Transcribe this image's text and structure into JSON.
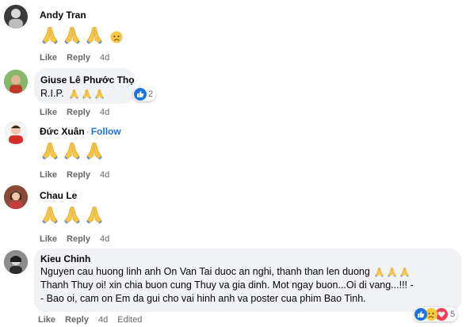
{
  "comments": [
    {
      "author": "Andy Tran",
      "text": "",
      "emoji_count": 3,
      "extra_emoji": "sad-emoji",
      "actions": {
        "like": "Like",
        "reply": "Reply",
        "time": "4d"
      }
    },
    {
      "author": "Giuse Lê Phước Thọ",
      "text": "R.I.P.",
      "emoji_count": 3,
      "reaction_count": "2",
      "actions": {
        "like": "Like",
        "reply": "Reply",
        "time": "4d"
      }
    },
    {
      "author": "Đức Xuân",
      "follow": "Follow",
      "text": "",
      "emoji_count": 3,
      "actions": {
        "like": "Like",
        "reply": "Reply",
        "time": "4d"
      }
    },
    {
      "author": "Chau Le",
      "text": "",
      "emoji_count": 3,
      "actions": {
        "like": "Like",
        "reply": "Reply",
        "time": "4d"
      }
    },
    {
      "author": "Kieu Chinh",
      "text_line1": "Nguyen cau huong linh anh On Van Tai duoc an nghi, thanh than len duong",
      "text_line2": "Thanh Thuy oi! xin chia buon cung Thuy va gia dinh. Mot ngay buon...Oi di vang...!!! -",
      "text_line3": "- Bao oi, cam on Em da gui cho vai hinh anh va poster cua phim Bao Tinh.",
      "emoji_count": 3,
      "reaction_count": "5",
      "actions": {
        "like": "Like",
        "reply": "Reply",
        "time": "4d",
        "edited": "Edited"
      }
    }
  ],
  "colors": {
    "bubble": "#f0f2f5",
    "link_blue": "#216fdb",
    "meta_gray": "#65676b",
    "pray_yellow": "#f6c745"
  },
  "icons": {
    "pray": "folded-hands-emoji",
    "sad": "sad-face-emoji",
    "like": "thumbs-up-reaction",
    "love": "heart-reaction"
  }
}
